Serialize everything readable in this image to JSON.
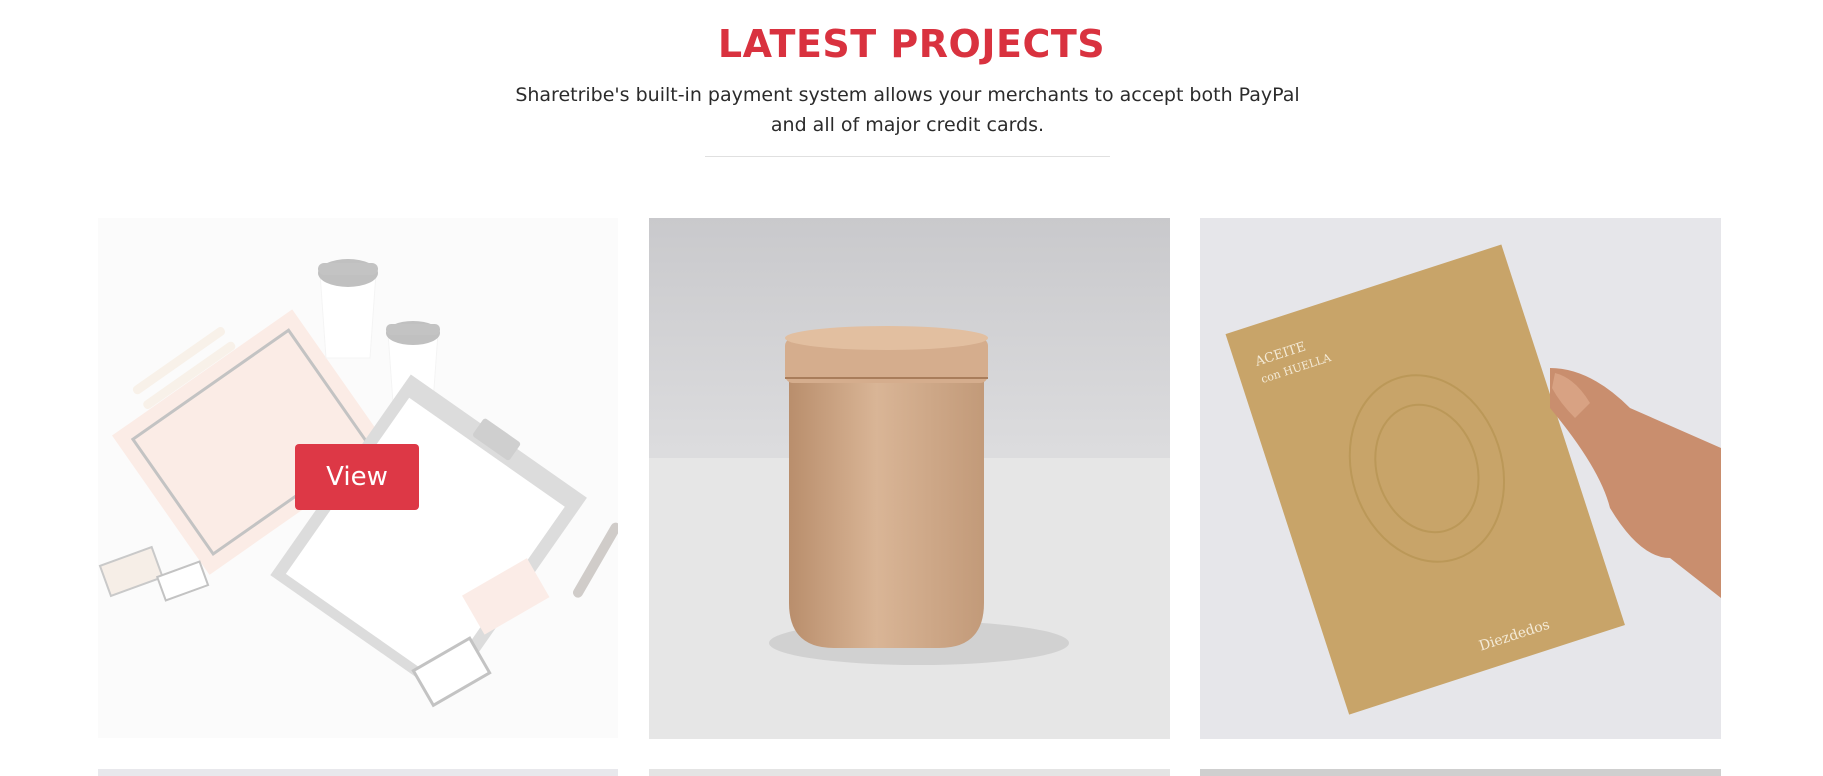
{
  "section": {
    "title": "LATEST PROJECTS",
    "subtitle": "Sharetribe's built-in payment system allows your merchants to accept both PayPal and all of major credit cards."
  },
  "projects": [
    {
      "view_label": "View",
      "image": "stationery-mockup-image"
    },
    {
      "image": "wooden-jar-image"
    },
    {
      "image": "book-cover-image",
      "cover_text_top": "ACEITE con HUELLA",
      "cover_text_bottom": "Diezdedos"
    }
  ],
  "colors": {
    "accent": "#d9323f",
    "button": "#dd3846"
  }
}
